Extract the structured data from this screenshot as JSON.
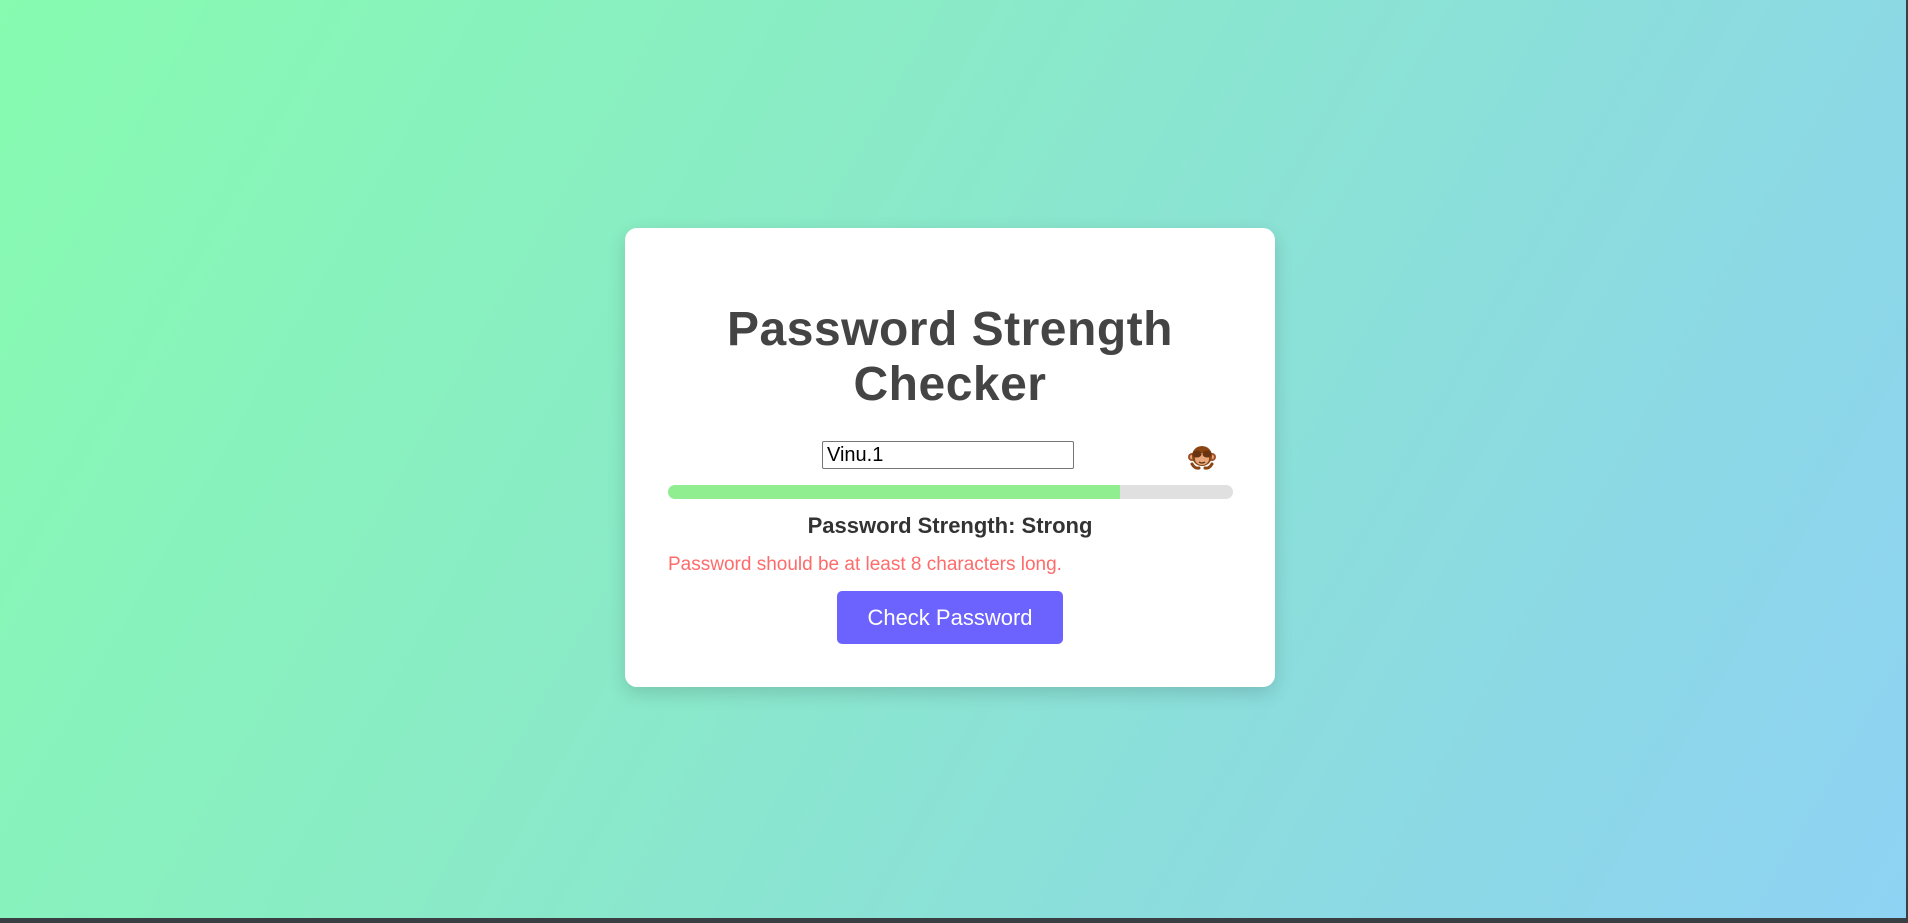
{
  "page": {
    "title": "Password Strength Checker"
  },
  "form": {
    "password_value": "Vinu.1",
    "toggle_icon": "see-no-evil-monkey-icon",
    "strength_label": "Password Strength: ",
    "strength_value": "Strong",
    "strength_fraction": 0.8,
    "feedback": "Password should be at least 8 characters long.",
    "button_label": "Check Password"
  },
  "colors": {
    "gradient_start": "#87fbb0",
    "gradient_end": "#8fd3f4",
    "card": "#ffffff",
    "title": "#444444",
    "progress_fill": "#90ee90",
    "progress_track": "#e0e0e0",
    "feedback": "#ff6b6b",
    "button": "#6c63ff"
  }
}
